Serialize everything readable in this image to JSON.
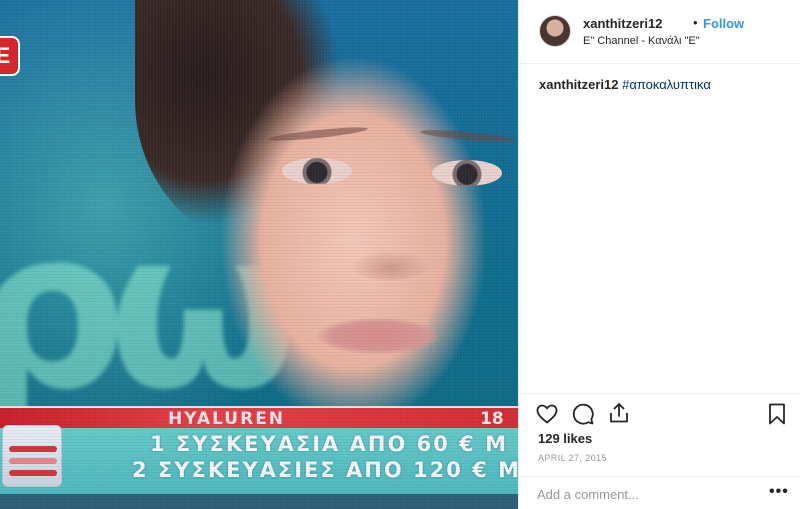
{
  "post": {
    "username": "xanthitzeri12",
    "separator": "•",
    "follow_label": "Follow",
    "location": "E\" Channel - Κανάλι \"Ε\"",
    "caption_user": "xanthitzeri12",
    "caption_text": "#αποκαλυπτικα",
    "likes": "129 likes",
    "date": "APRIL 27, 2015",
    "comment_placeholder": "Add a comment...",
    "more_label": "•••"
  },
  "media": {
    "channel_logo": "E",
    "ticker_title": "HYALUREN",
    "ticker_number": "18",
    "ticker_line1": "1 ΣΥΣΚΕΥΑΣΙΑ ΑΠΟ 60 € Μ",
    "ticker_line2": "2 ΣΥΣΚΕΥΑΣΙΕΣ ΑΠΟ 120 € Μ",
    "bg_letters": "ρω"
  },
  "icons": {
    "heart": "heart-icon",
    "comment": "comment-icon",
    "share": "share-icon",
    "save": "bookmark-icon"
  },
  "colors": {
    "link_blue": "#3897f0",
    "hashtag": "#003569",
    "ticker_red": "#d42c35",
    "ticker_cyan": "#5bc0c4"
  }
}
